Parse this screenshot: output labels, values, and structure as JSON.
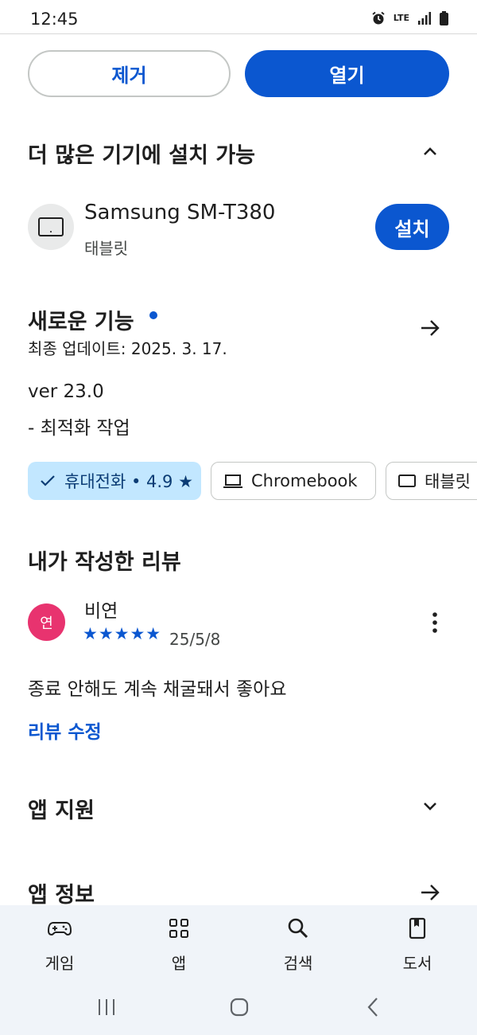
{
  "status": {
    "time": "12:45",
    "network": "LTE"
  },
  "actions": {
    "remove_label": "제거",
    "open_label": "열기"
  },
  "install_section": {
    "title": "더 많은 기기에 설치 가능",
    "device_name": "Samsung SM-T380",
    "device_type": "태블릿",
    "install_label": "설치"
  },
  "whats_new": {
    "title": "새로운 기능",
    "updated": "최종 업데이트: 2025. 3. 17.",
    "version": "ver 23.0",
    "note": "- 최적화 작업"
  },
  "chips": [
    {
      "label": "휴대전화 • 4.9 ★",
      "icon": "check-icon",
      "selected": true
    },
    {
      "label": "Chromebook",
      "icon": "laptop-icon",
      "selected": false
    },
    {
      "label": "태블릿 •",
      "icon": "tablet-icon",
      "selected": false
    }
  ],
  "my_review": {
    "title": "내가 작성한 리뷰",
    "avatar_letter": "연",
    "avatar_color": "#e8336f",
    "author": "비연",
    "stars": 5,
    "stars_text": "★★★★★",
    "date": "25/5/8",
    "text": "종료 안해도 계속 채굴돼서 좋아요",
    "edit_label": "리뷰 수정"
  },
  "app_support": {
    "title": "앱 지원"
  },
  "app_info": {
    "title": "앱 정보"
  },
  "bottom_nav": [
    {
      "label": "게임",
      "icon": "gamepad-icon"
    },
    {
      "label": "앱",
      "icon": "apps-grid-icon"
    },
    {
      "label": "검색",
      "icon": "search-icon"
    },
    {
      "label": "도서",
      "icon": "book-icon"
    }
  ],
  "colors": {
    "accent": "#0b57d0",
    "chip_selected": "#c2e7ff",
    "nav_bg": "#f0f4f9"
  }
}
